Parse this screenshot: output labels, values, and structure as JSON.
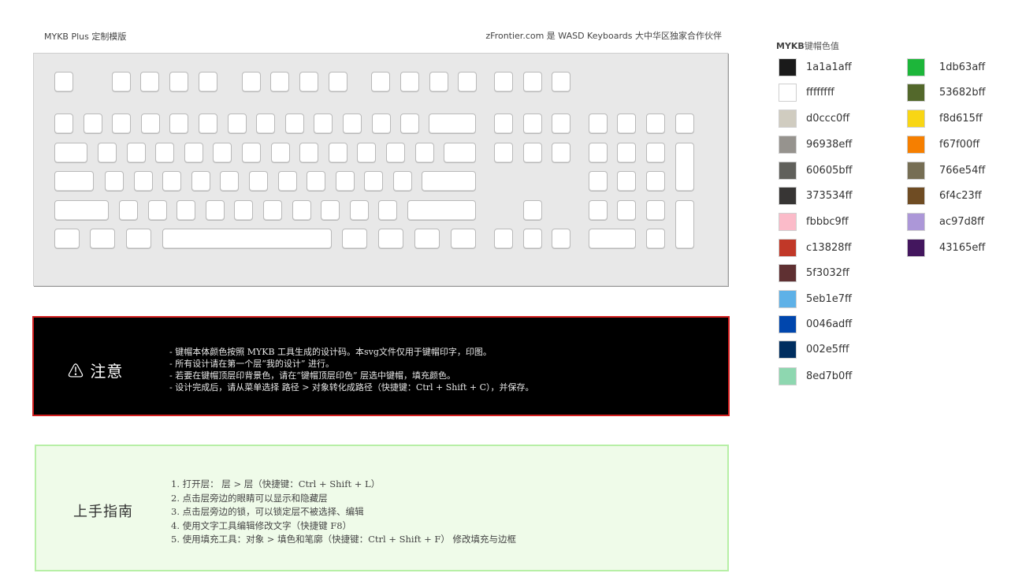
{
  "header": {
    "left_title": "MYKB Plus 定制模版",
    "right_credit": "zFrontier.com 是 WASD Keyboards 大中华区独家合作伙伴"
  },
  "notice": {
    "icon": "warning-triangle-icon",
    "title": "⚠ 注意",
    "lines": [
      "- 键帽本体颜色按照 MYKB 工具生成的设计码。本svg文件仅用于键帽印字，印图。",
      "- 所有设计请在第一个层“我的设计” 进行。",
      "- 若要在键帽顶层印背景色，请在“键帽顶层印色” 层选中键帽，填充颜色。",
      "- 设计完成后，请从菜单选择 路径 > 对象转化成路径（快捷键：Ctrl + Shift + C），并保存。"
    ]
  },
  "guide": {
    "title": "上手指南",
    "lines": [
      "1.  打开层： 层 > 层（快捷键：Ctrl + Shift + L）",
      "2.  点击层旁边的眼睛可以显示和隐藏层",
      "3.  点击层旁边的锁，可以锁定层不被选择、编辑",
      "4.  使用文字工具编辑修改文字（快捷键 F8）",
      "5.  使用填充工具：对象 > 填色和笔廓（快捷键：Ctrl + Shift + F） 修改填充与边框"
    ]
  },
  "palette": {
    "title_bold": "MYKB",
    "title_rest": "键帽色值",
    "left": [
      {
        "label": "1a1a1aff",
        "color": "#1a1a1a"
      },
      {
        "label": "ffffffff",
        "color": "#ffffff"
      },
      {
        "label": "d0ccc0ff",
        "color": "#d0ccc0"
      },
      {
        "label": "96938eff",
        "color": "#96938e"
      },
      {
        "label": "60605bff",
        "color": "#60605b"
      },
      {
        "label": "373534ff",
        "color": "#373534"
      },
      {
        "label": "fbbbc9ff",
        "color": "#fbbbc9"
      },
      {
        "label": "c13828ff",
        "color": "#c13828"
      },
      {
        "label": "5f3032ff",
        "color": "#5f3032"
      },
      {
        "label": "5eb1e7ff",
        "color": "#5eb1e7"
      },
      {
        "label": "0046adff",
        "color": "#0046ad"
      },
      {
        "label": "002e5fff",
        "color": "#002e5f"
      },
      {
        "label": "8ed7b0ff",
        "color": "#8ed7b0"
      }
    ],
    "right": [
      {
        "label": "1db63aff",
        "color": "#1db63a"
      },
      {
        "label": "53682bff",
        "color": "#53682b"
      },
      {
        "label": "f8d615ff",
        "color": "#f8d615"
      },
      {
        "label": "f67f00ff",
        "color": "#f67f00"
      },
      {
        "label": "766e54ff",
        "color": "#766e54"
      },
      {
        "label": "6f4c23ff",
        "color": "#6f4c23"
      },
      {
        "label": "ac97d8ff",
        "color": "#ac97d8"
      },
      {
        "label": "43165eff",
        "color": "#43165e"
      }
    ]
  }
}
